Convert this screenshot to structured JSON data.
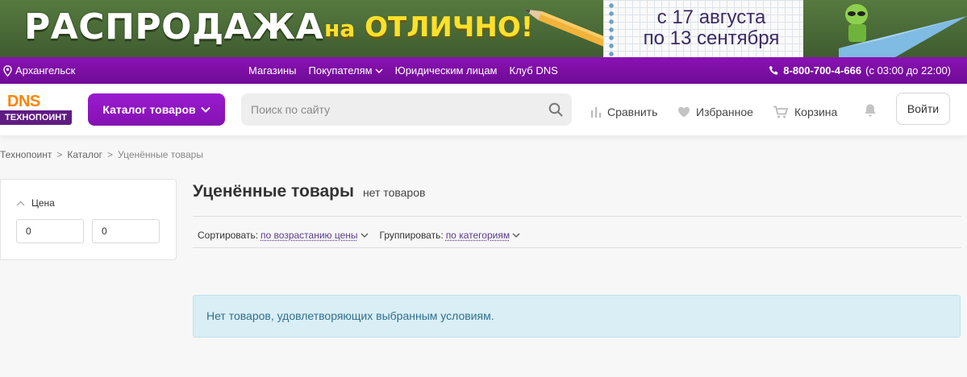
{
  "banner": {
    "title": "РАСПРОДАЖА",
    "subtitle_small": "на",
    "subtitle_big": "ОТЛИЧНО!",
    "date_line1": "с 17 августа",
    "date_line2": "по 13 сентября"
  },
  "topbar": {
    "city": "Архангельск",
    "nav": [
      "Магазины",
      "Покупателям",
      "Юридическим лицам",
      "Клуб DNS"
    ],
    "phone": "8-800-700-4-666",
    "hours": "(с 03:00 до 22:00)"
  },
  "header": {
    "logo_top": "DNS",
    "logo_bottom": "ТЕХНОПОИНТ",
    "catalog_label": "Каталог товаров",
    "search_placeholder": "Поиск по сайту",
    "compare_label": "Сравнить",
    "favorites_label": "Избранное",
    "cart_label": "Корзина",
    "login_label": "Войти"
  },
  "breadcrumbs": [
    "Технопоинт",
    "Каталог",
    "Уценённые товары"
  ],
  "filter": {
    "title": "Цена",
    "min_value": "0",
    "max_value": "0"
  },
  "main": {
    "title": "Уценённые товары",
    "count": "нет товаров",
    "sort_label": "Сортировать:",
    "sort_value": "по возрастанию цены",
    "group_label": "Группировать:",
    "group_value": "по категориям",
    "empty_message": "Нет товаров, удовлетворяющих выбранным условиям."
  },
  "colors": {
    "brand_purple": "#7b0aa4",
    "brand_orange": "#fc8507",
    "alert_bg": "#d9eef5"
  }
}
